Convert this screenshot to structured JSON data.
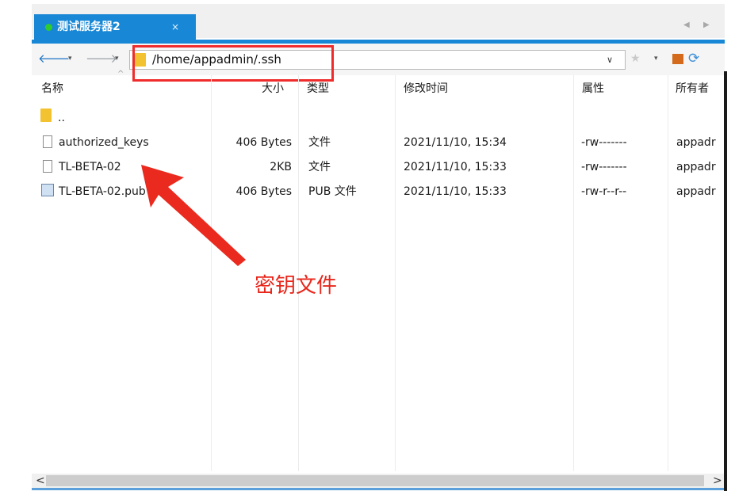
{
  "tab": {
    "title": "测试服务器2",
    "close_glyph": "×"
  },
  "tab_nav": {
    "prev": "◀",
    "next": "▶"
  },
  "toolbar": {
    "back_glyph": "🡐",
    "forward_glyph": "🡒",
    "dropdown_glyph": "▾",
    "address": "/home/appadmin/.ssh",
    "address_dropdown_glyph": "∨",
    "star_glyph": "★",
    "refresh_glyph": "⟳"
  },
  "columns": {
    "name": "名称",
    "size": "大小",
    "type": "类型",
    "modified": "修改时间",
    "attributes": "属性",
    "owner": "所有者"
  },
  "files": [
    {
      "name": "..",
      "size": "",
      "type": "",
      "modified": "",
      "attributes": "",
      "owner": "",
      "icon": "folder-icon"
    },
    {
      "name": "authorized_keys",
      "size": "406 Bytes",
      "type": "文件",
      "modified": "2021/11/10, 15:34",
      "attributes": "-rw-------",
      "owner": "appadr",
      "icon": "file-icon"
    },
    {
      "name": "TL-BETA-02",
      "size": "2KB",
      "type": "文件",
      "modified": "2021/11/10, 15:33",
      "attributes": "-rw-------",
      "owner": "appadr",
      "icon": "file-icon"
    },
    {
      "name": "TL-BETA-02.pub",
      "size": "406 Bytes",
      "type": "PUB 文件",
      "modified": "2021/11/10, 15:33",
      "attributes": "-rw-r--r--",
      "owner": "appadr",
      "icon": "pub-file-icon"
    }
  ],
  "annotation": {
    "text": "密钥文件",
    "color": "#e8261b"
  },
  "scrollbar": {
    "left_glyph": "<",
    "right_glyph": ">"
  },
  "colors": {
    "accent": "#1787d6",
    "highlight": "#ef2b2b",
    "tab_dot": "#2ecc2e"
  }
}
